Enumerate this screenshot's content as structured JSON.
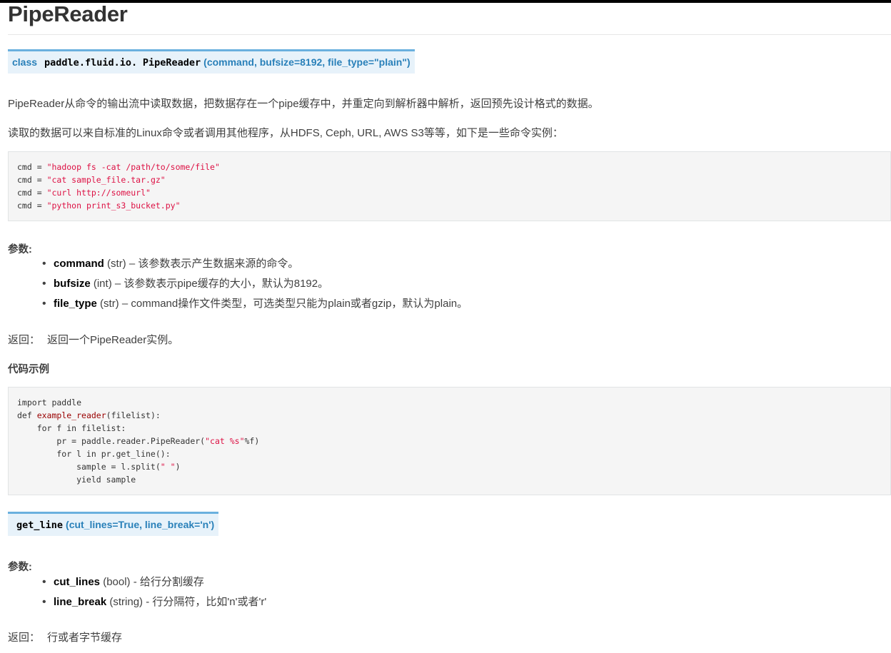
{
  "page": {
    "title": "PipeReader"
  },
  "class_signature": {
    "keyword": "class",
    "module": "paddle.fluid.io.",
    "name": "PipeReader",
    "params": "(command, bufsize=8192, file_type=\"plain\")"
  },
  "description": {
    "p1": "PipeReader从命令的输出流中读取数据，把数据存在一个pipe缓存中，并重定向到解析器中解析，返回预先设计格式的数据。",
    "p2": "读取的数据可以来自标准的Linux命令或者调用其他程序，从HDFS, Ceph, URL, AWS S3等等，如下是一些命令实例："
  },
  "cmd_examples": [
    {
      "var": "cmd",
      "op": " = ",
      "str": "\"hadoop fs -cat /path/to/some/file\""
    },
    {
      "var": "cmd",
      "op": " = ",
      "str": "\"cat sample_file.tar.gz\""
    },
    {
      "var": "cmd",
      "op": " = ",
      "str": "\"curl http://someurl\""
    },
    {
      "var": "cmd",
      "op": " = ",
      "str": "\"python print_s3_bucket.py\""
    }
  ],
  "params_section": {
    "label": "参数:",
    "items": [
      {
        "name": "command",
        "type": " (str) – ",
        "desc": "该参数表示产生数据来源的命令。"
      },
      {
        "name": "bufsize",
        "type": " (int) – ",
        "desc": "该参数表示pipe缓存的大小，默认为8192。"
      },
      {
        "name": "file_type",
        "type": " (str) – ",
        "desc": "command操作文件类型，可选类型只能为plain或者gzip，默认为plain。"
      }
    ]
  },
  "returns_1": {
    "label": "返回：",
    "value": "返回一个PipeReader实例。"
  },
  "code_example_heading": "代码示例",
  "code_example": {
    "l1": "import paddle",
    "l2_kw": "def ",
    "l2_fn": "example_reader",
    "l2_rest": "(filelist):",
    "l3": "    for f in filelist:",
    "l4_a": "        pr = paddle.reader.PipeReader(",
    "l4_str": "\"cat %s\"",
    "l4_b": "%f)",
    "l5": "        for l in pr.get_line():",
    "l6_a": "            sample = l.split(",
    "l6_str": "\" \"",
    "l6_b": ")",
    "l7": "            yield sample"
  },
  "method_signature": {
    "name": "get_line",
    "params": "(cut_lines=True, line_break='n')"
  },
  "method_params": {
    "label": "参数:",
    "items": [
      {
        "name": "cut_lines",
        "type": " (bool) - ",
        "desc": "给行分割缓存"
      },
      {
        "name": "line_break",
        "type": " (string) - ",
        "desc": "行分隔符，比如'n'或者'r'"
      }
    ]
  },
  "returns_2": {
    "label": "返回：",
    "value": "行或者字节缓存"
  },
  "colors": {
    "signature_bg": "#e7f2fa",
    "signature_border": "#6ab0de",
    "signature_text": "#2980b9",
    "string": "#dd1144"
  }
}
